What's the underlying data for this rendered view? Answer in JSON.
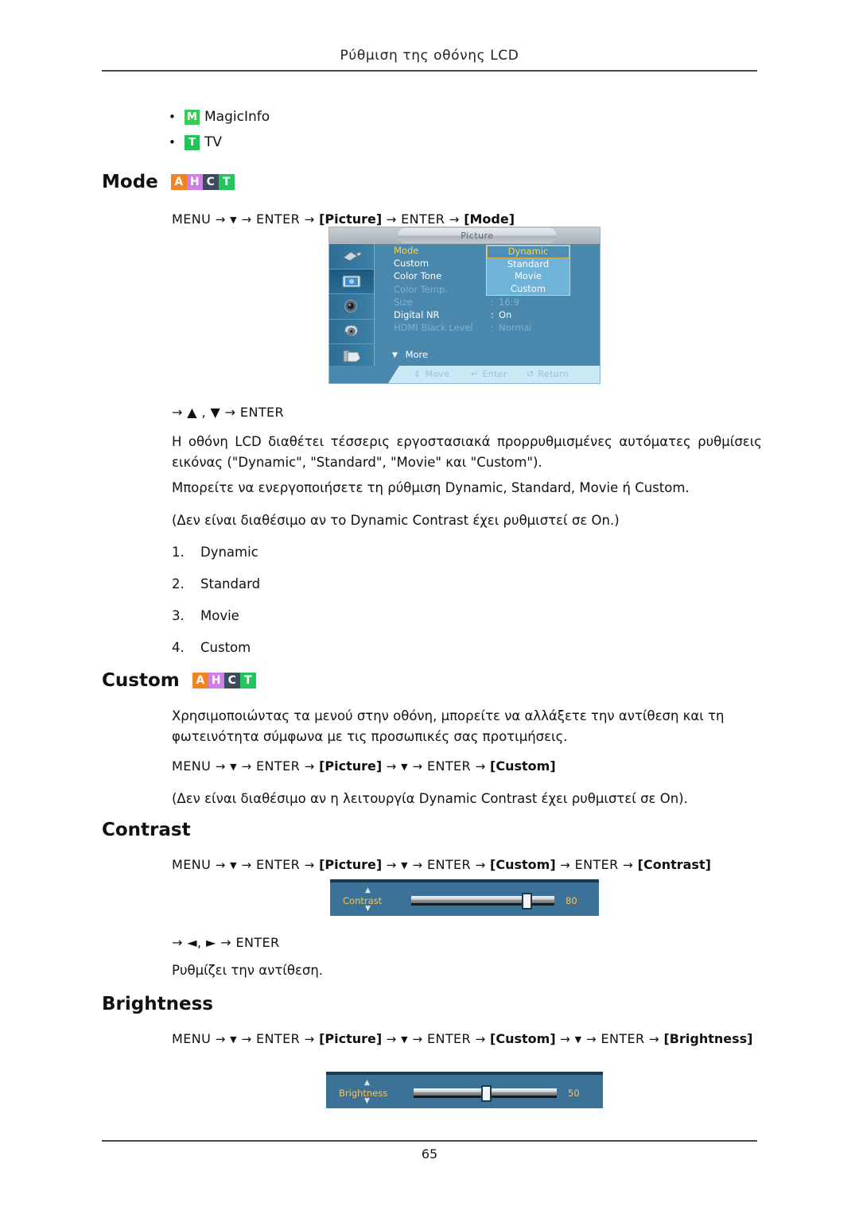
{
  "header": {
    "title": "Ρύθμιση της οθόνης LCD"
  },
  "footer": {
    "page_number": "65"
  },
  "bullets": [
    {
      "badge": "M",
      "badge_color": "#33cc55",
      "label": "MagicInfo"
    },
    {
      "badge": "T",
      "badge_color": "#23c55b",
      "label": "TV"
    }
  ],
  "tag_colors": {
    "A": "#f58220",
    "H": "#d17fe8",
    "C": "#3e4a5e",
    "T": "#22c55e"
  },
  "sections": {
    "mode": {
      "heading": "Mode",
      "tags": [
        "A",
        "H",
        "C",
        "T"
      ],
      "nav": {
        "menu": "MENU",
        "enter": "ENTER",
        "picture": "[Picture]",
        "target": "[Mode]"
      },
      "nav_keys": "→ ▲ , ▼ → ENTER",
      "paragraph_1": "Η οθόνη LCD διαθέτει τέσσερις εργοστασιακά προρρυθμισμένες αυτόματες ρυθμίσεις εικόνας (\"Dynamic\", \"Standard\", \"Movie\" και \"Custom\").",
      "paragraph_2": "Μπορείτε να ενεργοποιήσετε τη ρύθμιση Dynamic, Standard, Movie ή Custom.",
      "paragraph_3": "(Δεν είναι διαθέσιμο αν το Dynamic Contrast έχει ρυθμιστεί σε On.)",
      "options": [
        "Dynamic",
        "Standard",
        "Movie",
        "Custom"
      ]
    },
    "custom": {
      "heading": "Custom",
      "tags": [
        "A",
        "H",
        "C",
        "T"
      ],
      "paragraph_1": "Χρησιμοποιώντας τα μενού στην οθόνη, μπορείτε να αλλάξετε την αντίθεση και τη φωτεινότητα σύμφωνα με τις προσωπικές σας προτιμήσεις.",
      "nav_target": "[Custom]",
      "paragraph_2": "(Δεν είναι διαθέσιμο αν η λειτουργία Dynamic Contrast έχει ρυθμιστεί σε On)."
    },
    "contrast": {
      "heading": "Contrast",
      "nav_target": "[Contrast]",
      "nav_keys": "→ ◄, ► → ENTER",
      "description": "Ρυθμίζει την αντίθεση.",
      "slider": {
        "label": "Contrast",
        "value": "80",
        "percent": 80
      }
    },
    "brightness": {
      "heading": "Brightness",
      "nav_target": "[Brightness]",
      "slider": {
        "label": "Brightness",
        "value": "50",
        "percent": 50
      }
    }
  },
  "osd": {
    "title": "Picture",
    "icons": [
      "input-icon",
      "picture-icon",
      "sound-icon",
      "setup-icon",
      "multi-control-icon"
    ],
    "rows": [
      {
        "label": "Mode",
        "colon": ":",
        "value": "",
        "state": "active"
      },
      {
        "label": "Custom",
        "colon": "",
        "value": "",
        "state": "normal"
      },
      {
        "label": "Color Tone",
        "colon": ":",
        "value": "",
        "state": "normal"
      },
      {
        "label": "Color Temp.",
        "colon": "",
        "value": "",
        "state": "dim"
      },
      {
        "label": "Size",
        "colon": ":",
        "value": "16:9",
        "state": "dim"
      },
      {
        "label": "Digital NR",
        "colon": ":",
        "value": "On",
        "state": "normal"
      },
      {
        "label": "HDMI Black Level",
        "colon": ":",
        "value": "Normal",
        "state": "dim"
      }
    ],
    "more_label": "More",
    "dropdown": [
      "Dynamic",
      "Standard",
      "Movie",
      "Custom"
    ],
    "dropdown_selected": "Dynamic",
    "hints": [
      {
        "glyph": "⇕",
        "label": "Move"
      },
      {
        "glyph": "↵",
        "label": "Enter"
      },
      {
        "glyph": "↺",
        "label": "Return"
      }
    ]
  }
}
